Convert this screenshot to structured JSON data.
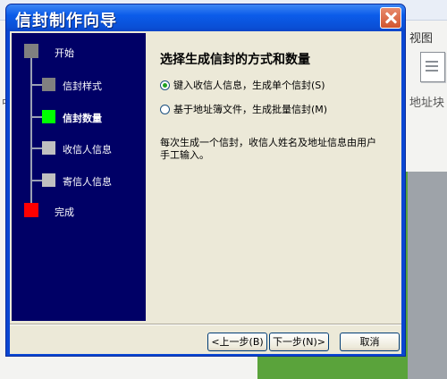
{
  "background": {
    "view_label": "视图",
    "address_label": "地址块",
    "left_char": "中"
  },
  "dialog": {
    "title": "信封制作向导",
    "steps": [
      {
        "label": "开始",
        "color": "#808080",
        "current": false
      },
      {
        "label": "信封样式",
        "color": "#808080",
        "current": false
      },
      {
        "label": "信封数量",
        "color": "#00ff00",
        "current": true
      },
      {
        "label": "收信人信息",
        "color": "#c0c0c0",
        "current": false
      },
      {
        "label": "寄信人信息",
        "color": "#c0c0c0",
        "current": false
      },
      {
        "label": "完成",
        "color": "#ff0000",
        "current": false
      }
    ],
    "heading": "选择生成信封的方式和数量",
    "options": [
      {
        "label": "键入收信人信息，生成单个信封(S)",
        "checked": true
      },
      {
        "label": "基于地址簿文件，生成批量信封(M)",
        "checked": false
      }
    ],
    "description": "每次生成一个信封，收信人姓名及地址信息由用户手工输入。",
    "buttons": {
      "back": "<上一步(B)",
      "next": "下一步(N)>",
      "cancel": "取消"
    }
  }
}
